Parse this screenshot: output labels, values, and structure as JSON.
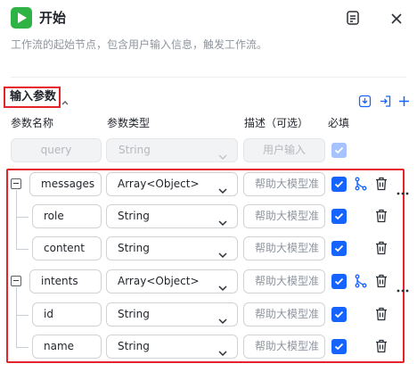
{
  "header": {
    "title": "开始",
    "app_icon": "play-icon",
    "doc_icon": "document-icon",
    "close_icon": "close-icon"
  },
  "description": "工作流的起始节点，包含用户输入信息，触发工作流。",
  "section": {
    "title": "输入参数",
    "toggle_icon": "chevron-up-icon",
    "tool_icons": [
      "import-icon",
      "login-icon",
      "add-icon"
    ]
  },
  "columns": {
    "name": "参数名称",
    "type": "参数类型",
    "desc": "描述（可选）",
    "required": "必填"
  },
  "default_row": {
    "name": "query",
    "type": "String",
    "desc": "用户输入",
    "required": true
  },
  "rows": [
    {
      "name": "messages",
      "type": "Array<Object>",
      "desc_placeholder": "帮助大模型准",
      "required": true,
      "level": 0,
      "collapsible": true
    },
    {
      "name": "role",
      "type": "String",
      "desc_placeholder": "帮助大模型准",
      "required": true,
      "level": 1
    },
    {
      "name": "content",
      "type": "String",
      "desc_placeholder": "帮助大模型准",
      "required": true,
      "level": 1
    },
    {
      "name": "intents",
      "type": "Array<Object>",
      "desc_placeholder": "帮助大模型准",
      "required": true,
      "level": 0,
      "collapsible": true
    },
    {
      "name": "id",
      "type": "String",
      "desc_placeholder": "帮助大模型准",
      "required": true,
      "level": 1
    },
    {
      "name": "name",
      "type": "String",
      "desc_placeholder": "帮助大模型准",
      "required": true,
      "level": 1
    }
  ],
  "colors": {
    "accent": "#1664ff",
    "brand_green": "#2fb344",
    "highlight": "#e3242b"
  }
}
